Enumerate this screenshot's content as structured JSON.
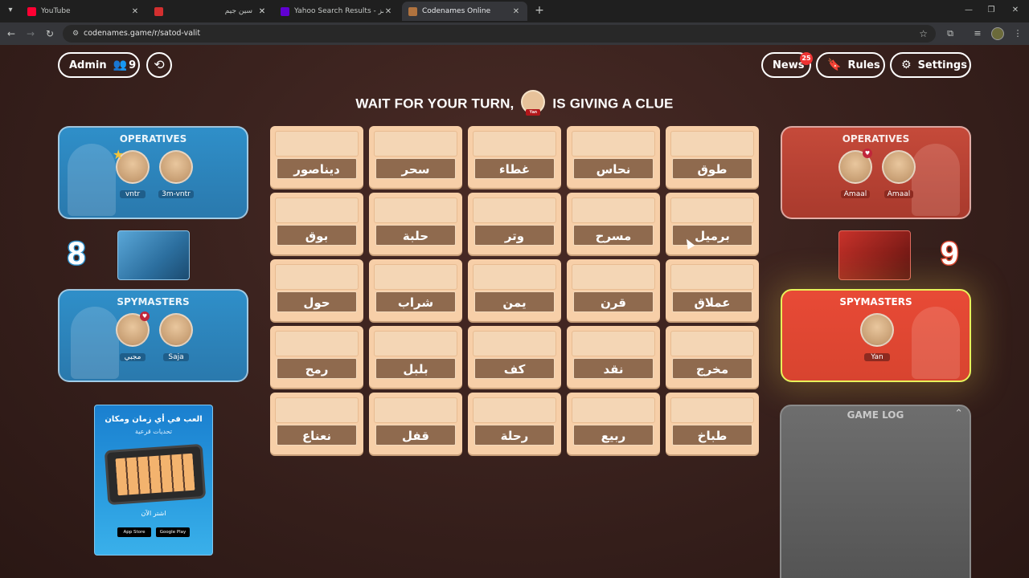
{
  "browser": {
    "tabs": [
      {
        "title": "YouTube",
        "favicon_color": "#ff0033"
      },
      {
        "title": "",
        "favicon_color": "#d32f2f"
      },
      {
        "title": "سين جيم",
        "favicon_color": "#e65100"
      },
      {
        "title": "Yahoo Search Results - كود نيمز",
        "favicon_color": "#6001d2"
      },
      {
        "title": "Codenames Online",
        "favicon_color": "#b0733f",
        "active": true
      }
    ],
    "url": "codenames.game/r/satod-valit"
  },
  "header": {
    "admin_label": "Admin",
    "player_count": "9",
    "news_label": "News",
    "news_badge": "25",
    "rules_label": "Rules",
    "settings_label": "Settings"
  },
  "status": {
    "before": "WAIT FOR YOUR TURN,",
    "after": "IS GIVING A CLUE",
    "avatar_name": "Yan"
  },
  "blue_team": {
    "color": "#2f8fc9",
    "score": "8",
    "operatives_title": "OPERATIVES",
    "operatives": [
      "vntr",
      "3m-vntr"
    ],
    "spymasters_title": "SPYMASTERS",
    "spymasters": [
      "مجبي",
      "Saja"
    ]
  },
  "red_team": {
    "color": "#d8442f",
    "score": "9",
    "operatives_title": "OPERATIVES",
    "operatives": [
      "Amaal",
      "Amaal"
    ],
    "spymasters_title": "SPYMASTERS",
    "spymasters": [
      "Yan"
    ]
  },
  "board": {
    "words": [
      "ديناصور",
      "سحر",
      "غطاء",
      "نحاس",
      "طوق",
      "بوق",
      "حلبة",
      "وتر",
      "مسرح",
      "برميل",
      "حول",
      "شراب",
      "يمن",
      "قرن",
      "عملاق",
      "رمح",
      "بلبل",
      "كف",
      "نقد",
      "مخرج",
      "نعناع",
      "قفل",
      "رحلة",
      "ربيع",
      "طباخ"
    ]
  },
  "ad": {
    "title": "العب في أي زمان ومكان",
    "subtitle": "تحديات قرعية",
    "cta": "اشتر الآن",
    "app_store": "App Store",
    "google_play": "Google Play"
  },
  "game_log": {
    "title": "GAME LOG"
  }
}
